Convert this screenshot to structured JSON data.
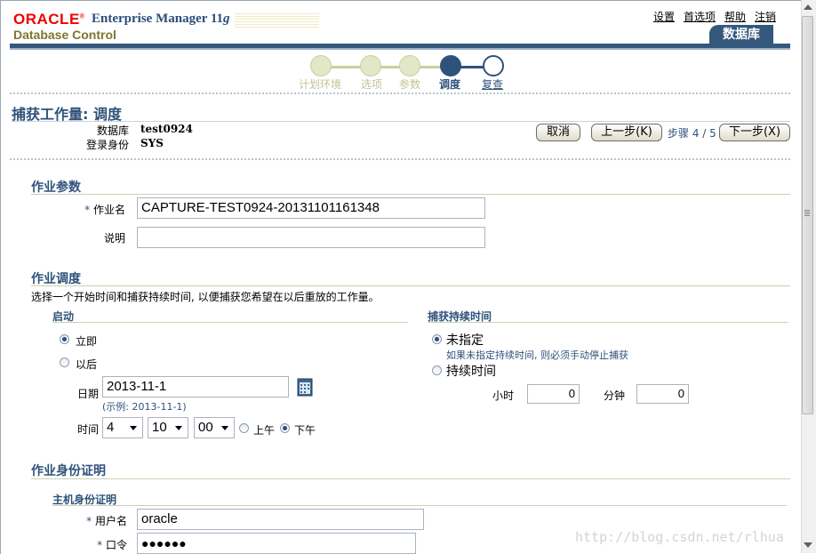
{
  "header": {
    "brand_oracle": "ORACLE",
    "brand_em": "Enterprise Manager 11",
    "brand_em_g": "g",
    "brand_product": "Database Control",
    "links": [
      "设置",
      "首选项",
      "帮助",
      "注销"
    ],
    "tab_label": "数据库"
  },
  "train": {
    "steps": [
      "计划环境",
      "选项",
      "参数",
      "调度",
      "复查"
    ],
    "current_index": 3
  },
  "page": {
    "title": "捕获工作量: 调度",
    "db_label": "数据库",
    "db_value": "test0924",
    "login_label": "登录身份",
    "login_value": "SYS",
    "cancel_button": "取消",
    "back_button": "上一步(K)",
    "step_label": "步骤",
    "step_value": "4 / 5",
    "next_button": "下一步(X)"
  },
  "job_params": {
    "heading": "作业参数",
    "name_label": "作业名",
    "name_value": "CAPTURE-TEST0924-20131101161348",
    "desc_label": "说明",
    "desc_value": ""
  },
  "job_schedule": {
    "heading": "作业调度",
    "description": "选择一个开始时间和捕获持续时间, 以便捕获您希望在以后重放的工作量。",
    "start_heading": "启动",
    "immediate_label": "立即",
    "later_label": "以后",
    "date_label": "日期",
    "date_value": "2013-11-1",
    "date_example": "(示例: 2013-11-1)",
    "time_label": "时间",
    "hour_value": "4",
    "minute_value": "10",
    "second_value": "00",
    "am_label": "上午",
    "pm_label": "下午",
    "duration_heading": "捕获持续时间",
    "unspecified_label": "未指定",
    "unspecified_hint": "如果未指定持续时间, 则必须手动停止捕获",
    "duration_label": "持续时间",
    "hours_label": "小时",
    "hours_value": "0",
    "minutes_label": "分钟",
    "minutes_value": "0"
  },
  "credentials": {
    "heading": "作业身份证明",
    "host_heading": "主机身份证明",
    "user_label": "用户名",
    "user_value": "oracle",
    "password_label": "口令",
    "password_value": "●●●●●●"
  },
  "watermark": "http://blog.csdn.net/rlhua"
}
